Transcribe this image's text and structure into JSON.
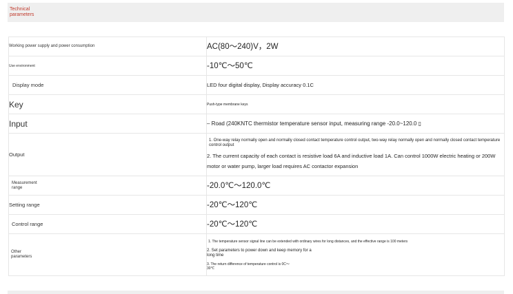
{
  "header": {
    "title": "Technical parameters"
  },
  "rows": [
    {
      "label": "Working power supply and power consumption",
      "value": "AC(80～240)V，2W"
    },
    {
      "label": "Use environment",
      "value": "-10℃～50℃"
    },
    {
      "label": "Display mode",
      "value": "LED four digital display, Display accuracy 0.1C"
    },
    {
      "label": "Key",
      "value": "Push-type membrane keys"
    },
    {
      "label": "Input",
      "value": "– Road (240KNTC thermistor temperature sensor input, measuring range -20.0~120.0 ▯"
    },
    {
      "label": "Output",
      "lines": [
        "1. One-way relay normally open and normally closed contact temperature control output, two-way relay normally open and normally closed contact temperature control output",
        "2. The current capacity of each contact is resistive load 6A and inductive load 1A. Can control 1000W electric heating or 200W motor or water pump, larger load requires AC contactor expansion"
      ]
    },
    {
      "label": "Measurement range",
      "value": "-20.0℃～120.0℃"
    },
    {
      "label": "Setting range",
      "value": "-20℃～120℃"
    },
    {
      "label": "Control range",
      "value": "-20℃～120℃"
    },
    {
      "label": "Other parameters",
      "lines": [
        "1. The temperature sensor signal line can be extended with ordinary wires for long distances, and the effective range is 100 meters",
        "2. Set parameters to power down and keep memory for a long time",
        "3. The return difference of temperature control is 0C～30℃"
      ]
    }
  ]
}
